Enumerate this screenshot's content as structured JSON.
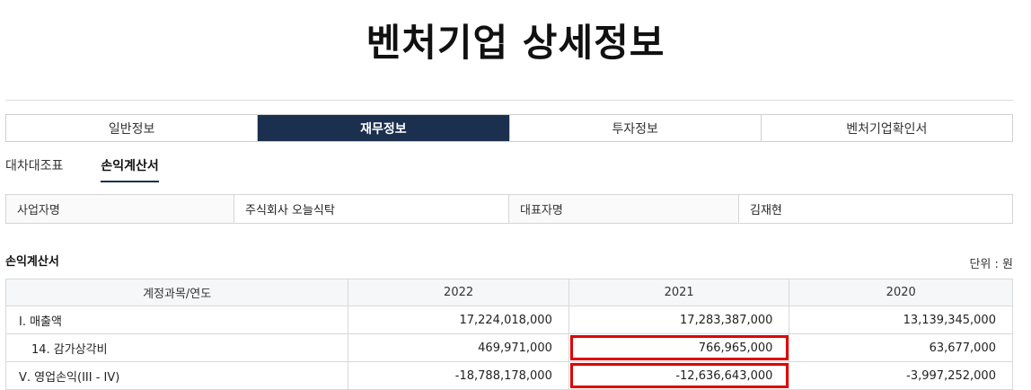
{
  "page": {
    "title": "벤처기업 상세정보"
  },
  "tabs": [
    {
      "label": "일반정보",
      "active": false
    },
    {
      "label": "재무정보",
      "active": true
    },
    {
      "label": "투자정보",
      "active": false
    },
    {
      "label": "벤처기업확인서",
      "active": false
    }
  ],
  "subtabs": [
    {
      "label": "대차대조표",
      "active": false
    },
    {
      "label": "손익계산서",
      "active": true
    }
  ],
  "company": {
    "name_label": "사업자명",
    "name_value": "주식회사 오늘식탁",
    "ceo_label": "대표자명",
    "ceo_value": "김재현"
  },
  "statement": {
    "title": "손익계산서",
    "unit": "단위 : 원",
    "headers": [
      "계정과목/연도",
      "2022",
      "2021",
      "2020"
    ],
    "rows": [
      {
        "account": "Ⅰ. 매출액",
        "y2022": "17,224,018,000",
        "y2021": "17,283,387,000",
        "y2020": "13,139,345,000"
      },
      {
        "account": "14. 감가상각비",
        "y2022": "469,971,000",
        "y2021": "766,965,000",
        "y2020": "63,677,000"
      },
      {
        "account": "Ⅴ. 영업손익(III - IV)",
        "y2022": "-18,788,178,000",
        "y2021": "-12,636,643,000",
        "y2020": "-3,997,252,000"
      }
    ]
  },
  "colors": {
    "active_tab": "#1b2f4e",
    "highlight": "#e00000"
  }
}
